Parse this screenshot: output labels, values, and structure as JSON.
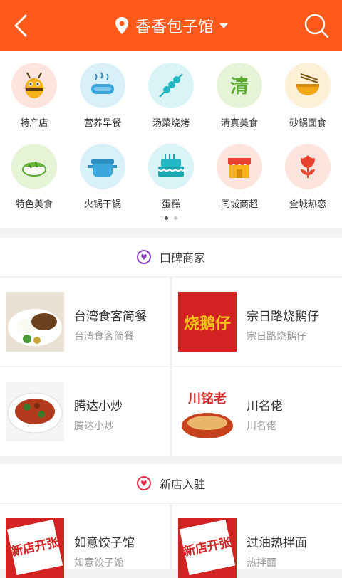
{
  "header": {
    "location": "香香包子馆",
    "back_icon": "chevron-left-icon",
    "search_icon": "search-icon",
    "bg_color": "#ff5a1a"
  },
  "categories": [
    {
      "label": "特产店",
      "icon": "bee-icon",
      "bg": "#fde4de"
    },
    {
      "label": "营养早餐",
      "icon": "sausage-steam-icon",
      "bg": "#d9f0f8"
    },
    {
      "label": "汤菜烧烤",
      "icon": "skewer-icon",
      "bg": "#d9f3f6"
    },
    {
      "label": "清真美食",
      "icon": "halal-qing-icon",
      "bg": "#e5f4d6"
    },
    {
      "label": "砂锅面食",
      "icon": "noodle-bowl-icon",
      "bg": "#fdf0d6"
    },
    {
      "label": "特色美食",
      "icon": "sushi-icon",
      "bg": "#e5f4d6"
    },
    {
      "label": "火锅干锅",
      "icon": "hotpot-icon",
      "bg": "#d9f0f8"
    },
    {
      "label": "蛋糕",
      "icon": "cake-icon",
      "bg": "#d9f3f6"
    },
    {
      "label": "同城商超",
      "icon": "store-icon",
      "bg": "#fde4de"
    },
    {
      "label": "全城热恋",
      "icon": "tulip-icon",
      "bg": "#fde4de"
    }
  ],
  "pager": {
    "total": 2,
    "active": 0
  },
  "sections": [
    {
      "title": "口碑商家",
      "heart_color": "#8a3fc0",
      "items": [
        {
          "name": "台湾食客简餐",
          "sub": "台湾食客简餐",
          "thumb": "rice-plate-photo"
        },
        {
          "name": "宗日路烧鹅仔",
          "sub": "宗日路烧鹅仔",
          "thumb": "shao-e-zai-sign",
          "thumb_text": "烧鹅仔"
        },
        {
          "name": "腾达小炒",
          "sub": "腾达小炒",
          "thumb": "stir-fry-photo"
        },
        {
          "name": "川名佬",
          "sub": "川名佬",
          "thumb": "chuan-ming-lao-sign",
          "thumb_text": "川铭老"
        }
      ]
    },
    {
      "title": "新店入驻",
      "heart_color": "#e0334a",
      "items": [
        {
          "name": "如意饺子馆",
          "sub": "如意饺子馆",
          "thumb": "new-shop-sign",
          "thumb_text": "新店开张"
        },
        {
          "name": "过油热拌面",
          "sub": "热拌面",
          "thumb": "new-shop-sign",
          "thumb_text": "新店开张"
        }
      ]
    }
  ]
}
